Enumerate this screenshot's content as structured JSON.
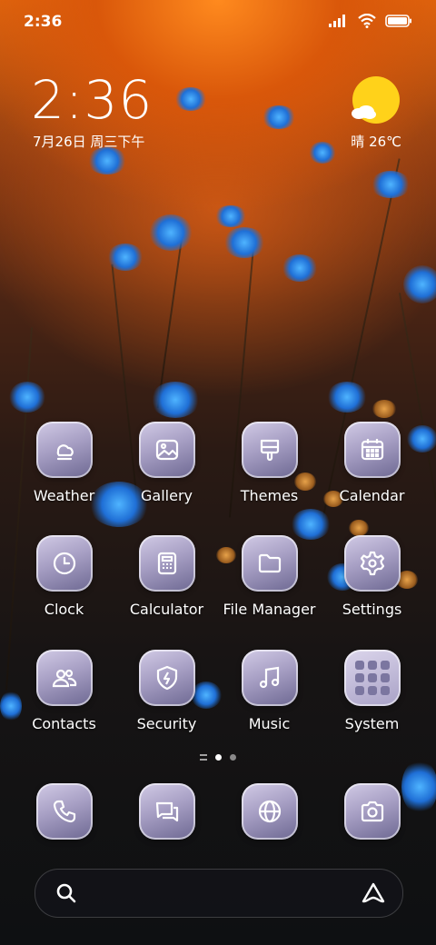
{
  "status_bar": {
    "time": "2:36",
    "icons": [
      "signal-icon",
      "wifi-icon",
      "battery-icon"
    ]
  },
  "clock_widget": {
    "time": "2:36",
    "date": "7月26日 周三下午"
  },
  "weather_widget": {
    "condition_temp": "晴 26℃",
    "icon": "sun-cloud-icon"
  },
  "apps": [
    {
      "label": "Weather",
      "icon": "cloud-sun-icon"
    },
    {
      "label": "Gallery",
      "icon": "image-icon"
    },
    {
      "label": "Themes",
      "icon": "brush-icon"
    },
    {
      "label": "Calendar",
      "icon": "calendar-icon"
    },
    {
      "label": "Clock",
      "icon": "clock-icon"
    },
    {
      "label": "Calculator",
      "icon": "calculator-icon"
    },
    {
      "label": "File Manager",
      "icon": "folder-icon"
    },
    {
      "label": "Settings",
      "icon": "gear-icon"
    },
    {
      "label": "Contacts",
      "icon": "contacts-icon"
    },
    {
      "label": "Security",
      "icon": "shield-icon"
    },
    {
      "label": "Music",
      "icon": "music-icon"
    },
    {
      "label": "System",
      "icon": "folder-grid-icon"
    }
  ],
  "page_indicator": {
    "pages": 2,
    "active": 1
  },
  "dock": [
    {
      "icon": "phone-icon"
    },
    {
      "icon": "messages-icon"
    },
    {
      "icon": "browser-icon"
    },
    {
      "icon": "camera-icon"
    }
  ],
  "search_bar": {
    "left_icon": "search-icon",
    "right_icon": "assistant-icon"
  },
  "colors": {
    "icon_bg_top": "#d2cbe6",
    "icon_bg_bottom": "#6d6892",
    "sun": "#ffd21a"
  }
}
